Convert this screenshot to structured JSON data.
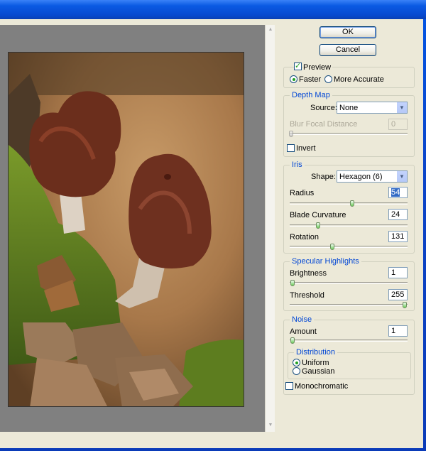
{
  "buttons": {
    "ok": "OK",
    "cancel": "Cancel"
  },
  "preview": {
    "label": "Preview",
    "checked": true
  },
  "quality": {
    "faster": "Faster",
    "more_accurate": "More Accurate",
    "selected": "Faster"
  },
  "depth_map": {
    "title": "Depth Map",
    "source_label": "Source:",
    "source_value": "None",
    "blur_focal_distance_label": "Blur Focal Distance",
    "blur_focal_distance_value": "0",
    "blur_focal_distance_slider": 0,
    "invert_label": "Invert"
  },
  "iris": {
    "title": "Iris",
    "shape_label": "Shape:",
    "shape_value": "Hexagon (6)",
    "radius_label": "Radius",
    "radius_value": "54",
    "radius_slider": 0.54,
    "blade_curvature_label": "Blade Curvature",
    "blade_curvature_value": "24",
    "blade_curvature_slider": 0.24,
    "rotation_label": "Rotation",
    "rotation_value": "131",
    "rotation_slider": 0.36
  },
  "specular": {
    "title": "Specular Highlights",
    "brightness_label": "Brightness",
    "brightness_value": "1",
    "brightness_slider": 0.01,
    "threshold_label": "Threshold",
    "threshold_value": "255",
    "threshold_slider": 1.0
  },
  "noise": {
    "title": "Noise",
    "amount_label": "Amount",
    "amount_value": "1",
    "amount_slider": 0.01,
    "distribution_title": "Distribution",
    "uniform": "Uniform",
    "gaussian": "Gaussian",
    "selected": "Uniform",
    "monochromatic_label": "Monochromatic"
  },
  "colors": {
    "title_bar": "#0b5ae3",
    "dialog_bg": "#ece9d8",
    "group_title": "#0046d5",
    "preview_bg": "#808080"
  },
  "icons": [
    "scroll-up-arrow-icon",
    "scroll-down-arrow-icon",
    "dropdown-arrow-icon",
    "checkmark-icon"
  ]
}
